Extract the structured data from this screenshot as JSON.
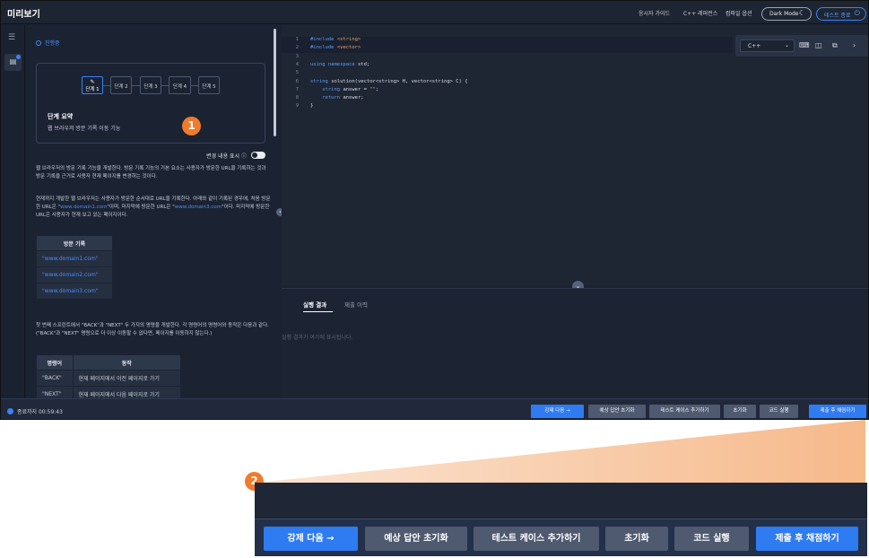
{
  "app": {
    "title": "미리보기"
  },
  "topbar": {
    "links": [
      "응시자 가이드",
      "C++ 레퍼런스",
      "컴파일 옵션"
    ],
    "dark_mode": "Dark Mode",
    "exit_test": "테스트 종료"
  },
  "problem": {
    "status": "진행중",
    "steps": [
      "단계 1",
      "단계 2",
      "단계 3",
      "단계 4",
      "단계 5"
    ],
    "summary_title": "단계 요약",
    "summary_text": "웹 브라우저 방문 기록 이동 기능",
    "show_changes": "변경 내용 표시",
    "para1": "웹 브라우저의 방문 기록 기능을 개발한다. 방문 기록 기능의 기본 요소는 사용자가 방문한 URL을 기록하는 것과 방문 기록을 근거로 사용자 현재 페이지를 변경하는 것이다.",
    "para2_a": "현재까지 개발한 웹 브라우저는 사용자가 방문한 순서대로 URL을 기록한다. 아래와 같이 기록된 경우에, 처음 방문한 URL은 \"",
    "para2_link1": "www.domain1.com",
    "para2_b": "\"이며, 마지막에 방문한 URL은 \"",
    "para2_link2": "www.domain3.com",
    "para2_c": "\"이다. 마지막에 방문한 URL은 사용자가 현재 보고 있는 페이지이다.",
    "history_table": {
      "header": "방문 기록",
      "rows": [
        "\"www.domain1.com\"",
        "\"www.domain2.com\"",
        "\"www.domain3.com\""
      ]
    },
    "para3": "첫 번째 스프린트에서 \"BACK\"과 \"NEXT\" 두 가지의 명령을 개발한다. 각 명령어의 명령어와 동작은 다음과 같다. (\"BACK\"과 \"NEXT\" 명령으로 더 이상 이동할 수 없다면, 페이지를 이동하지 않는다.)",
    "cmd_table": {
      "headers": [
        "명령어",
        "동작"
      ],
      "rows": [
        [
          "\"BACK\"",
          "현재 페이지에서 이전 페이지로 가기"
        ],
        [
          "\"NEXT\"",
          "현재 페이지에서 다음 페이지로 가기"
        ]
      ]
    }
  },
  "editor": {
    "language": "C++",
    "lines": [
      {
        "n": "1",
        "parts": [
          [
            "kw",
            "#include "
          ],
          [
            "str",
            "<string>"
          ]
        ]
      },
      {
        "n": "2",
        "parts": [
          [
            "kw",
            "#include "
          ],
          [
            "str",
            "<vector>"
          ]
        ]
      },
      {
        "n": "3",
        "parts": []
      },
      {
        "n": "4",
        "parts": [
          [
            "kw",
            "using namespace "
          ],
          [
            "",
            "std;"
          ]
        ]
      },
      {
        "n": "5",
        "parts": []
      },
      {
        "n": "6",
        "parts": [
          [
            "kw",
            "string "
          ],
          [
            "",
            "solution(vector<string> H, vector<string> C) {"
          ]
        ]
      },
      {
        "n": "7",
        "parts": [
          [
            "",
            "    "
          ],
          [
            "kw",
            "string "
          ],
          [
            "",
            "answer = "
          ],
          [
            "str",
            "\"\""
          ],
          [
            "",
            ";"
          ]
        ]
      },
      {
        "n": "8",
        "parts": [
          [
            "",
            "    "
          ],
          [
            "kw",
            "return "
          ],
          [
            "",
            "answer;"
          ]
        ]
      },
      {
        "n": "9",
        "parts": [
          [
            "",
            "}"
          ]
        ]
      }
    ]
  },
  "result": {
    "tab_result": "실행 결과",
    "tab_history": "제출 이력",
    "empty": "실행 결과가 여기에 표시됩니다."
  },
  "bottom": {
    "timer": "종료까지 00:59:43",
    "buttons": [
      "강제 다음 →",
      "예상 답안 초기화",
      "테스트 케이스 추가하기",
      "초기화",
      "코드 실행",
      "제출 후 채점하기"
    ]
  },
  "zoom": {
    "buttons": [
      "강제 다음  →",
      "예상 답안 초기화",
      "테스트 케이스 추가하기",
      "초기화",
      "코드 실행",
      "제출 후 채점하기"
    ]
  },
  "callouts": [
    "1",
    "2"
  ],
  "colors": {
    "accent": "#2f7bf1",
    "callout": "#f07b2c",
    "bg": "#1b2333"
  }
}
